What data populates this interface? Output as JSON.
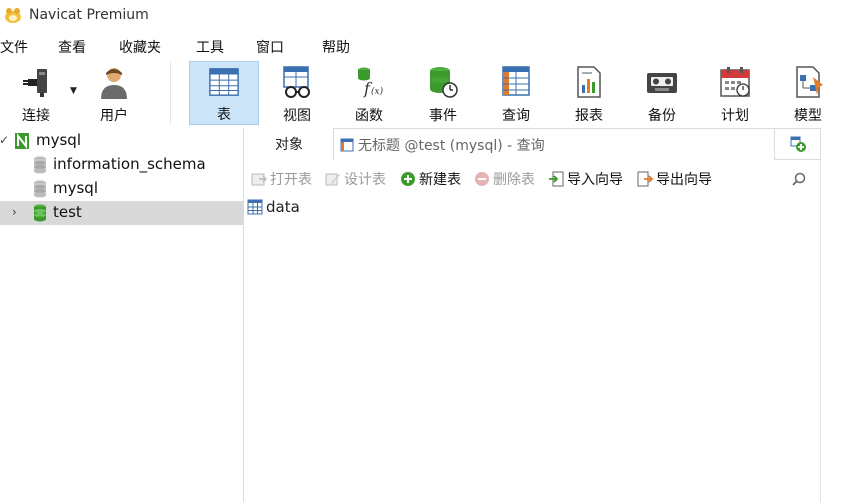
{
  "window": {
    "title": "Navicat Premium",
    "logo_icon": "navicat-logo-icon"
  },
  "menubar": {
    "items": [
      {
        "label": "文件"
      },
      {
        "label": "查看"
      },
      {
        "label": "收藏夹"
      },
      {
        "label": "工具"
      },
      {
        "label": "窗口"
      },
      {
        "label": "帮助"
      }
    ]
  },
  "toolbar": {
    "tools": [
      {
        "label": "连接",
        "icon": "plug-connect-icon"
      },
      {
        "label": "用户",
        "icon": "user-icon"
      },
      {
        "label": "表",
        "icon": "table-icon",
        "active": true
      },
      {
        "label": "视图",
        "icon": "view-glasses-icon"
      },
      {
        "label": "函数",
        "icon": "function-icon"
      },
      {
        "label": "事件",
        "icon": "event-clock-icon"
      },
      {
        "label": "查询",
        "icon": "query-icon"
      },
      {
        "label": "报表",
        "icon": "report-icon"
      },
      {
        "label": "备份",
        "icon": "backup-icon"
      },
      {
        "label": "计划",
        "icon": "calendar-icon"
      },
      {
        "label": "模型",
        "icon": "model-icon"
      }
    ]
  },
  "tree": {
    "connection": {
      "label": "mysql",
      "expanded": true
    },
    "databases": [
      {
        "label": "information_schema"
      },
      {
        "label": "mysql"
      },
      {
        "label": "test",
        "selected": true
      }
    ]
  },
  "tabs": {
    "objects_label": "对象",
    "query_label": "无标题 @test (mysql) - 查询"
  },
  "object_toolbar": {
    "open_table": "打开表",
    "design_table": "设计表",
    "new_table": "新建表",
    "delete_table": "删除表",
    "import_wizard": "导入向导",
    "export_wizard": "导出向导"
  },
  "object_list": {
    "tables": [
      {
        "name": "data"
      }
    ]
  },
  "colors": {
    "active_tool_bg": "#cce4f7",
    "selected_row_bg": "#d9d9d9",
    "db_green": "#3c9a2c"
  }
}
